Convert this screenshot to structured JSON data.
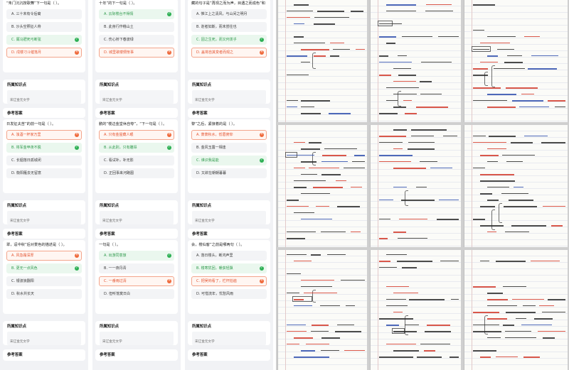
{
  "columns": [
    {
      "q1": {
        "stem": "“朱门沉沉按歌舞”下一句是（ ）。",
        "options": [
          {
            "letter": "A",
            "text": "三十未有令后裔",
            "state": "normal"
          },
          {
            "letter": "B",
            "text": "沙头空照征人骨",
            "state": "normal"
          },
          {
            "letter": "C",
            "text": "厩马肥死弓断弦",
            "state": "correct"
          },
          {
            "letter": "D",
            "text": "戍楼刁斗催落月",
            "state": "wrong"
          }
        ]
      },
      "k1": {
        "title": "所属知识点",
        "tag": "宋辽金元文学"
      },
      "a1": {
        "title": "参考答案"
      },
      "q2": {
        "stem": "日发征夫苦”的前一句是（ ）。",
        "options": [
          {
            "letter": "A",
            "text": "浊酒一杯家万里",
            "state": "wrong"
          },
          {
            "letter": "B",
            "text": "将军金甲夜不脱",
            "state": "correct"
          },
          {
            "letter": "C",
            "text": "长烟落日孤城闭",
            "state": "normal"
          },
          {
            "letter": "D",
            "text": "衡阳雁去无留意",
            "state": "normal"
          }
        ]
      },
      "k2": {
        "title": "所属知识点",
        "tag": "宋辽金元文学"
      },
      "a2": {
        "title": "参考答案"
      },
      "q3": {
        "stem": "翠，迢中秋”后对景色的描述是（ ）。",
        "options": [
          {
            "letter": "A",
            "text": "风急霜深厚",
            "state": "wrong"
          },
          {
            "letter": "B",
            "text": "更无一点风色",
            "state": "correct"
          },
          {
            "letter": "C",
            "text": "银波浪翻阳",
            "state": "normal"
          },
          {
            "letter": "D",
            "text": "秋水共长天",
            "state": "normal"
          }
        ]
      },
      "k3": {
        "title": "所属知识点",
        "tag": "宋辽金元文学"
      },
      "a3": {
        "title": "参考答案"
      }
    },
    {
      "q1": {
        "stem": "十年”的下一句是（ ）。",
        "options": [
          {
            "letter": "A",
            "text": "云际楼台不得情",
            "state": "correct"
          },
          {
            "letter": "B",
            "text": "此身行作稽山土",
            "state": "normal"
          },
          {
            "letter": "C",
            "text": "伤心桥下春波绿",
            "state": "normal"
          },
          {
            "letter": "D",
            "text": "城里歌楼惆怅事",
            "state": "wrong"
          }
        ]
      },
      "k1": {
        "title": "所属知识点",
        "tag": "宋辽金元文学"
      },
      "a1": {
        "title": "参考答案"
      },
      "q2": {
        "stem": "鹏的“楼边金堂休自夸”，“下一句是（ ）。",
        "options": [
          {
            "letter": "A",
            "text": "只有金屋藏人眼",
            "state": "wrong"
          },
          {
            "letter": "B",
            "text": "从此别，只有雕昂",
            "state": "correct"
          },
          {
            "letter": "C",
            "text": "看试补，补无影",
            "state": "normal"
          },
          {
            "letter": "D",
            "text": "正回事来河路图",
            "state": "normal"
          }
        ]
      },
      "k2": {
        "title": "所属知识点",
        "tag": "宋辽金元文学"
      },
      "a2": {
        "title": "参考答案"
      },
      "q3": {
        "stem": "一句是（ ）。",
        "options": [
          {
            "letter": "A",
            "text": "出游同意旅",
            "state": "correct"
          },
          {
            "letter": "B",
            "text": "一一夜丹青",
            "state": "normal"
          },
          {
            "letter": "C",
            "text": "一番雨过清",
            "state": "wrong"
          },
          {
            "letter": "D",
            "text": "但听落寞日白",
            "state": "normal"
          }
        ]
      },
      "k3": {
        "title": "所属知识点",
        "tag": "宋辽金元文学"
      },
      "a3": {
        "title": "参考答案"
      }
    },
    {
      "q1": {
        "stem": "藏的句子是”再现之而为声，目遇之而成色”和（ ）。",
        "options": [
          {
            "letter": "A",
            "text": "惟江上之清风，与山间之明月",
            "state": "normal"
          },
          {
            "letter": "B",
            "text": "逝者如斯，而未尝往也",
            "state": "normal"
          },
          {
            "letter": "C",
            "text": "固之生死，而又何羡乎",
            "state": "correct"
          },
          {
            "letter": "D",
            "text": "盖将自其变者而观之",
            "state": "wrong"
          }
        ]
      },
      "k1": {
        "title": "所属知识点",
        "tag": "宋辽金元文学"
      },
      "a1": {
        "title": "参考答案"
      },
      "q2": {
        "stem": "黎”之后，紧接着的是（ ）。",
        "options": [
          {
            "letter": "A",
            "text": "萧萧秋水，低眉俯仰",
            "state": "wrong"
          },
          {
            "letter": "B",
            "text": "金风玉露一相逢",
            "state": "normal"
          },
          {
            "letter": "C",
            "text": "谁识我是能",
            "state": "correct"
          },
          {
            "letter": "D",
            "text": "又欲在朝朝暮暮",
            "state": "normal"
          }
        ]
      },
      "k2": {
        "title": "所属知识点",
        "tag": "宋辽金元文学"
      },
      "a2": {
        "title": "参考答案"
      },
      "q3": {
        "stem": "会，楼仙客”之前是哪两句（ ）。",
        "options": [
          {
            "letter": "A",
            "text": "落日楼头，断鸿声里",
            "state": "normal"
          },
          {
            "letter": "B",
            "text": "楼寒犹回，暖获轻飘",
            "state": "correct"
          },
          {
            "letter": "C",
            "text": "把吴钩看了，栏杆拍遍",
            "state": "wrong"
          },
          {
            "letter": "D",
            "text": "可惜流年，忧愁风雨",
            "state": "normal"
          }
        ]
      },
      "k3": {
        "title": "所属知识点",
        "tag": "宋辽金元文学"
      },
      "a3": {
        "title": "参考答案"
      }
    }
  ],
  "colors": {
    "correct": "#2fb055",
    "wrong": "#ef6a3c",
    "panel_bg": "#f1f2f5",
    "notebook_paper": "#fbfbf8",
    "ink_red": "#d23a2c",
    "ink_blue": "#2f4fae"
  },
  "icons": {
    "correct": "check-circle-icon",
    "wrong": "cross-circle-icon"
  }
}
